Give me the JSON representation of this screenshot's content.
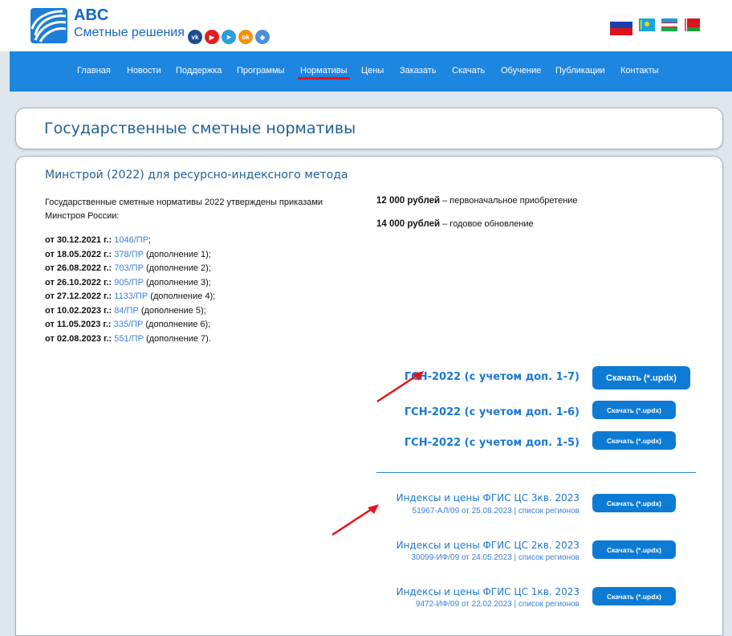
{
  "brand": {
    "name": "ABC",
    "tagline": "Сметные решения",
    "socials": [
      {
        "icon": "vk-icon",
        "glyph": "vk",
        "color": "#1a4f8f"
      },
      {
        "icon": "youtube-icon",
        "glyph": "▶",
        "color": "#e02020"
      },
      {
        "icon": "telegram-icon",
        "glyph": "➤",
        "color": "#2a9fd8"
      },
      {
        "icon": "ok-icon",
        "glyph": "ok",
        "color": "#f2920d"
      },
      {
        "icon": "shield-icon",
        "glyph": "◆",
        "color": "#4a90d9"
      }
    ]
  },
  "flags": [
    "flag-russia",
    "flag-kazakhstan",
    "flag-uzbekistan",
    "flag-belarus"
  ],
  "nav": [
    {
      "label": "Главная"
    },
    {
      "label": "Новости"
    },
    {
      "label": "Поддержка"
    },
    {
      "label": "Программы"
    },
    {
      "label": "Нормативы",
      "active": true
    },
    {
      "label": "Цены"
    },
    {
      "label": "Заказать"
    },
    {
      "label": "Скачать"
    },
    {
      "label": "Обучение"
    },
    {
      "label": "Публикации"
    },
    {
      "label": "Контакты"
    }
  ],
  "page_title": "Государственные сметные нормативы",
  "section": {
    "title": "Минстрой (2022) для ресурсно-индексного метода",
    "intro": "Государственные сметные нормативы 2022 утверждены приказами Минстроя России:",
    "orders": [
      {
        "date": "от 30.12.2021 г.:",
        "link": "1046/ПР",
        "note": ";"
      },
      {
        "date": "от 18.05.2022 г.:",
        "link": "378/ПР",
        "note": " (дополнение 1);"
      },
      {
        "date": "от 26.08.2022 г.:",
        "link": "703/ПР",
        "note": " (дополнение 2);"
      },
      {
        "date": "от 26.10.2022 г.:",
        "link": "905/ПР",
        "note": " (дополнение 3);"
      },
      {
        "date": "от 27.12.2022 г.:",
        "link": "1133/ПР",
        "note": " (дополнение 4);"
      },
      {
        "date": "от 10.02.2023 г.:",
        "link": "84/ПР",
        "note": " (дополнение 5);"
      },
      {
        "date": "от 11.05.2023 г.:",
        "link": "335/ПР",
        "note": " (дополнение 6);"
      },
      {
        "date": "от 02.08.2023 г.:",
        "link": "551/ПР",
        "note": " (дополнение 7)."
      }
    ],
    "prices": [
      {
        "amount": "12 000 рублей",
        "desc": " – первоначальное приобретение"
      },
      {
        "amount": "14 000 рублей",
        "desc": " – годовое обновление"
      }
    ],
    "downloads": [
      {
        "label": "ГСН-2022 (с учетом доп. 1-7)",
        "button": "Скачать (*.updx)"
      },
      {
        "label": "ГСН-2022 (с учетом доп. 1-6)",
        "button": "Скачать (*.updx)"
      },
      {
        "label": "ГСН-2022 (с учетом доп. 1-5)",
        "button": "Скачать (*.updx)"
      }
    ],
    "indexes": [
      {
        "title": "Индексы и цены ФГИС ЦС 3кв. 2023",
        "sub": "51967-АЛ/09 от 25.08.2023 | список регионов",
        "button": "Скачать (*.updx)"
      },
      {
        "title": "Индексы и цены ФГИС ЦС 2кв. 2023",
        "sub": "30099-ИФ/09 от 24.05.2023 | список регионов",
        "button": "Скачать (*.updx)"
      },
      {
        "title": "Индексы и цены ФГИС ЦС 1кв. 2023",
        "sub": "9472-ИФ/09 от 22.02.2023 | список регионов",
        "button": "Скачать (*.updx)"
      }
    ]
  },
  "colors": {
    "nav": "#1d86e0",
    "accent": "#1b78cf",
    "button": "#0d7bd3",
    "annotation": "#e1141a"
  }
}
